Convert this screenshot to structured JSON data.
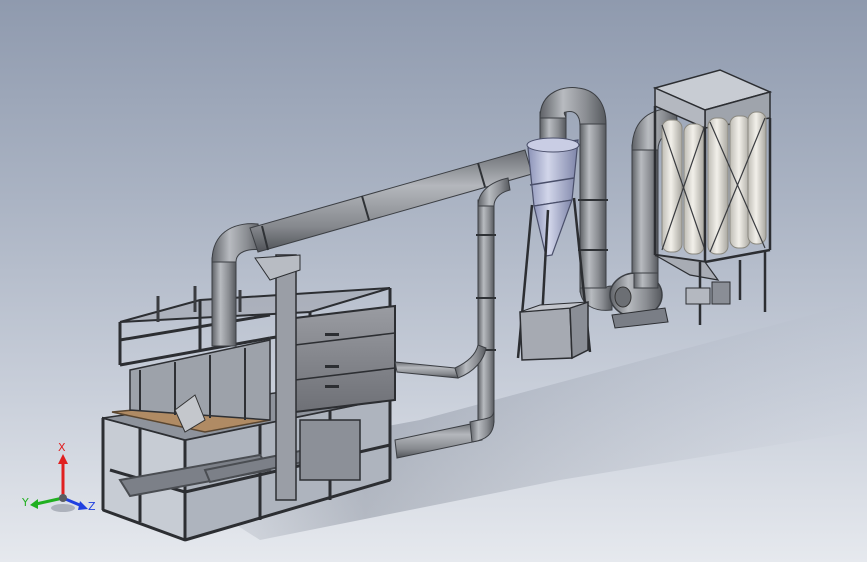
{
  "triad": {
    "x_label": "X",
    "y_label": "Y",
    "z_label": "Z",
    "x_color": "#e02020",
    "y_color": "#20b020",
    "z_color": "#2040e0"
  },
  "colors": {
    "background_top": "#8f9aae",
    "background_bottom": "#e6e9ee",
    "pipe": "#8a8d92",
    "frame": "#3a3c40",
    "filter_cartridge": "#e8e6e0"
  }
}
